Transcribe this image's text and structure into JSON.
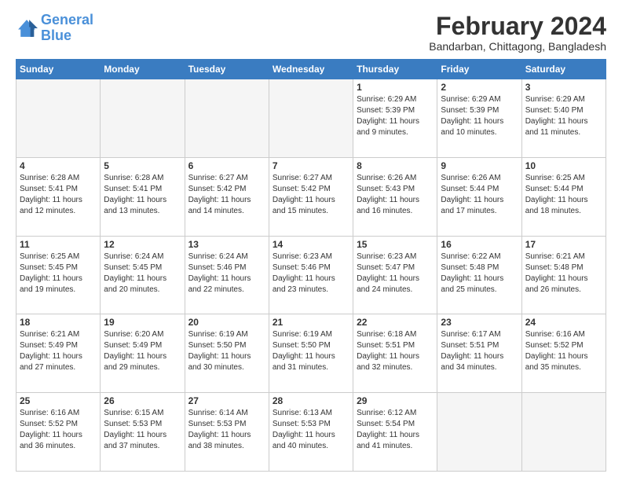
{
  "logo": {
    "line1": "General",
    "line2": "Blue"
  },
  "title": "February 2024",
  "subtitle": "Bandarban, Chittagong, Bangladesh",
  "days_of_week": [
    "Sunday",
    "Monday",
    "Tuesday",
    "Wednesday",
    "Thursday",
    "Friday",
    "Saturday"
  ],
  "weeks": [
    [
      {
        "day": "",
        "info": ""
      },
      {
        "day": "",
        "info": ""
      },
      {
        "day": "",
        "info": ""
      },
      {
        "day": "",
        "info": ""
      },
      {
        "day": "1",
        "info": "Sunrise: 6:29 AM\nSunset: 5:39 PM\nDaylight: 11 hours and 9 minutes."
      },
      {
        "day": "2",
        "info": "Sunrise: 6:29 AM\nSunset: 5:39 PM\nDaylight: 11 hours and 10 minutes."
      },
      {
        "day": "3",
        "info": "Sunrise: 6:29 AM\nSunset: 5:40 PM\nDaylight: 11 hours and 11 minutes."
      }
    ],
    [
      {
        "day": "4",
        "info": "Sunrise: 6:28 AM\nSunset: 5:41 PM\nDaylight: 11 hours and 12 minutes."
      },
      {
        "day": "5",
        "info": "Sunrise: 6:28 AM\nSunset: 5:41 PM\nDaylight: 11 hours and 13 minutes."
      },
      {
        "day": "6",
        "info": "Sunrise: 6:27 AM\nSunset: 5:42 PM\nDaylight: 11 hours and 14 minutes."
      },
      {
        "day": "7",
        "info": "Sunrise: 6:27 AM\nSunset: 5:42 PM\nDaylight: 11 hours and 15 minutes."
      },
      {
        "day": "8",
        "info": "Sunrise: 6:26 AM\nSunset: 5:43 PM\nDaylight: 11 hours and 16 minutes."
      },
      {
        "day": "9",
        "info": "Sunrise: 6:26 AM\nSunset: 5:44 PM\nDaylight: 11 hours and 17 minutes."
      },
      {
        "day": "10",
        "info": "Sunrise: 6:25 AM\nSunset: 5:44 PM\nDaylight: 11 hours and 18 minutes."
      }
    ],
    [
      {
        "day": "11",
        "info": "Sunrise: 6:25 AM\nSunset: 5:45 PM\nDaylight: 11 hours and 19 minutes."
      },
      {
        "day": "12",
        "info": "Sunrise: 6:24 AM\nSunset: 5:45 PM\nDaylight: 11 hours and 20 minutes."
      },
      {
        "day": "13",
        "info": "Sunrise: 6:24 AM\nSunset: 5:46 PM\nDaylight: 11 hours and 22 minutes."
      },
      {
        "day": "14",
        "info": "Sunrise: 6:23 AM\nSunset: 5:46 PM\nDaylight: 11 hours and 23 minutes."
      },
      {
        "day": "15",
        "info": "Sunrise: 6:23 AM\nSunset: 5:47 PM\nDaylight: 11 hours and 24 minutes."
      },
      {
        "day": "16",
        "info": "Sunrise: 6:22 AM\nSunset: 5:48 PM\nDaylight: 11 hours and 25 minutes."
      },
      {
        "day": "17",
        "info": "Sunrise: 6:21 AM\nSunset: 5:48 PM\nDaylight: 11 hours and 26 minutes."
      }
    ],
    [
      {
        "day": "18",
        "info": "Sunrise: 6:21 AM\nSunset: 5:49 PM\nDaylight: 11 hours and 27 minutes."
      },
      {
        "day": "19",
        "info": "Sunrise: 6:20 AM\nSunset: 5:49 PM\nDaylight: 11 hours and 29 minutes."
      },
      {
        "day": "20",
        "info": "Sunrise: 6:19 AM\nSunset: 5:50 PM\nDaylight: 11 hours and 30 minutes."
      },
      {
        "day": "21",
        "info": "Sunrise: 6:19 AM\nSunset: 5:50 PM\nDaylight: 11 hours and 31 minutes."
      },
      {
        "day": "22",
        "info": "Sunrise: 6:18 AM\nSunset: 5:51 PM\nDaylight: 11 hours and 32 minutes."
      },
      {
        "day": "23",
        "info": "Sunrise: 6:17 AM\nSunset: 5:51 PM\nDaylight: 11 hours and 34 minutes."
      },
      {
        "day": "24",
        "info": "Sunrise: 6:16 AM\nSunset: 5:52 PM\nDaylight: 11 hours and 35 minutes."
      }
    ],
    [
      {
        "day": "25",
        "info": "Sunrise: 6:16 AM\nSunset: 5:52 PM\nDaylight: 11 hours and 36 minutes."
      },
      {
        "day": "26",
        "info": "Sunrise: 6:15 AM\nSunset: 5:53 PM\nDaylight: 11 hours and 37 minutes."
      },
      {
        "day": "27",
        "info": "Sunrise: 6:14 AM\nSunset: 5:53 PM\nDaylight: 11 hours and 38 minutes."
      },
      {
        "day": "28",
        "info": "Sunrise: 6:13 AM\nSunset: 5:53 PM\nDaylight: 11 hours and 40 minutes."
      },
      {
        "day": "29",
        "info": "Sunrise: 6:12 AM\nSunset: 5:54 PM\nDaylight: 11 hours and 41 minutes."
      },
      {
        "day": "",
        "info": ""
      },
      {
        "day": "",
        "info": ""
      }
    ]
  ]
}
